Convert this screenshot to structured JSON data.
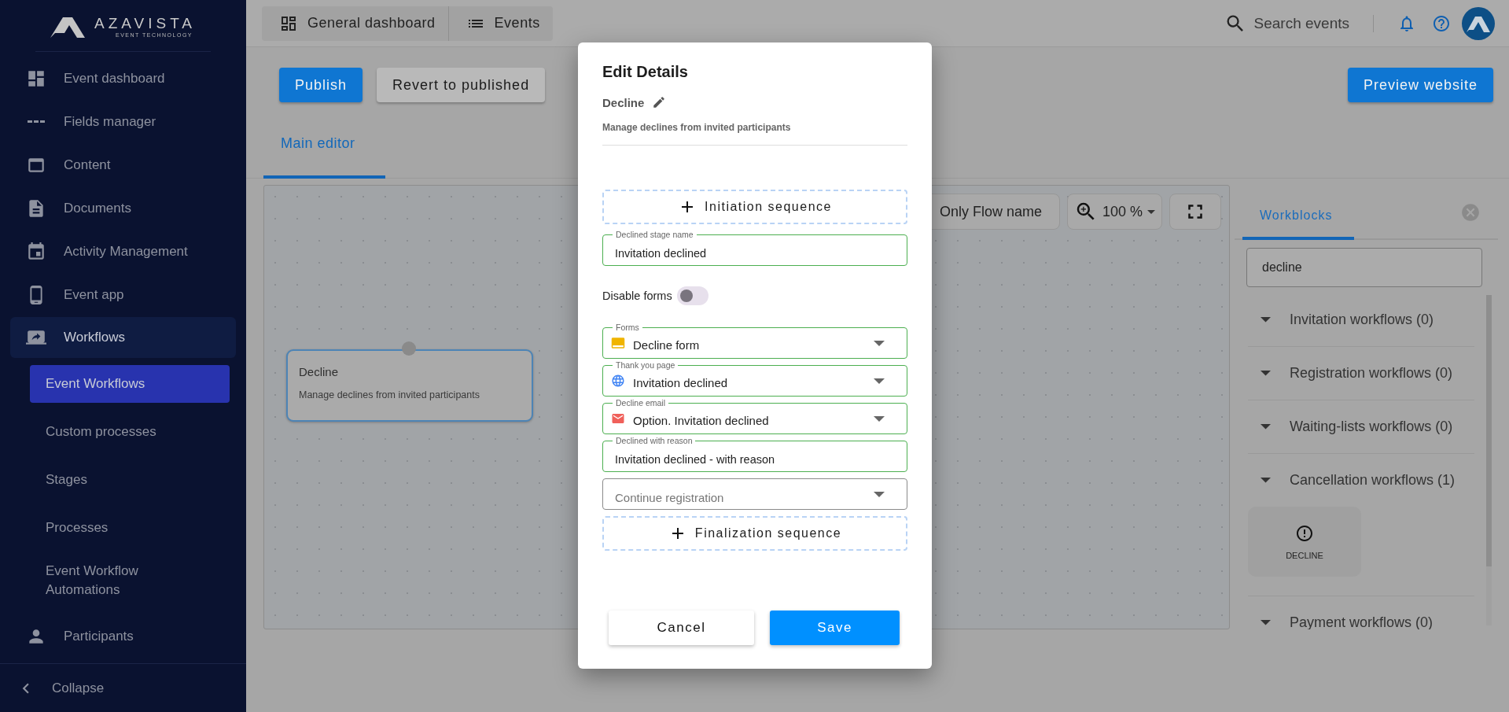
{
  "sidebar": {
    "logo": {
      "name": "AZAVISTA",
      "tagline": "EVENT TECHNOLOGY"
    },
    "items": [
      {
        "label": "Event dashboard",
        "selected": false
      },
      {
        "label": "Fields manager",
        "selected": false
      },
      {
        "label": "Content",
        "selected": false
      },
      {
        "label": "Documents",
        "selected": false
      },
      {
        "label": "Activity Management",
        "selected": false
      },
      {
        "label": "Event app",
        "selected": false
      },
      {
        "label": "Workflows",
        "selected": true,
        "expanded": true,
        "children": [
          {
            "label": "Event Workflows",
            "selected": true
          },
          {
            "label": "Custom processes",
            "selected": false
          },
          {
            "label": "Stages",
            "selected": false
          },
          {
            "label": "Processes",
            "selected": false
          },
          {
            "label": "Event Workflow Automations",
            "selected": false
          }
        ]
      },
      {
        "label": "Participants",
        "selected": false
      }
    ],
    "collapse": "Collapse"
  },
  "top_bar": {
    "nav": [
      "General dashboard",
      "Events"
    ],
    "search": "Search events"
  },
  "actions": {
    "publish": "Publish",
    "revert": "Revert to published",
    "preview": "Preview website"
  },
  "tabs": [
    {
      "label": "Main editor",
      "selected": true
    }
  ],
  "canvas": {
    "flow_name_toggle": "Only Flow name",
    "zoom": "100 %",
    "node": {
      "title": "Decline",
      "description": "Manage declines from invited participants"
    }
  },
  "workblocks": {
    "tabs": [
      {
        "label": "Workblocks",
        "selected": true
      }
    ],
    "search": "decline",
    "sections": [
      {
        "title": "Invitation workflows (0)",
        "expanded": true
      },
      {
        "title": "Registration workflows (0)",
        "expanded": true
      },
      {
        "title": "Waiting-lists workflows (0)",
        "expanded": true
      },
      {
        "title": "Cancellation workflows (1)",
        "expanded": true,
        "items": [
          "DECLINE"
        ]
      },
      {
        "title": "Payment workflows (0)",
        "expanded": true
      }
    ]
  },
  "dialog": {
    "title": "Edit Details",
    "name": "Decline",
    "description": "Manage declines from invited participants",
    "rows": [
      {
        "kind": "sequence",
        "label": "Initiation sequence"
      },
      {
        "kind": "text",
        "label": "Declined stage name",
        "value": "Invitation declined"
      },
      {
        "kind": "toggle",
        "label": "Disable forms",
        "on": false
      },
      {
        "kind": "select",
        "label": "Forms",
        "value": "Decline form"
      },
      {
        "kind": "select",
        "label": "Thank you page",
        "value": "Invitation declined"
      },
      {
        "kind": "select",
        "label": "Decline email",
        "value": "Option. Invitation declined"
      },
      {
        "kind": "text",
        "label": "Declined with reason",
        "value": "Invitation declined - with reason"
      },
      {
        "kind": "select",
        "placeholder": "Continue registration"
      },
      {
        "kind": "sequence",
        "label": "Finalization sequence"
      }
    ],
    "buttons": {
      "cancel": "Cancel",
      "save": "Save"
    }
  }
}
